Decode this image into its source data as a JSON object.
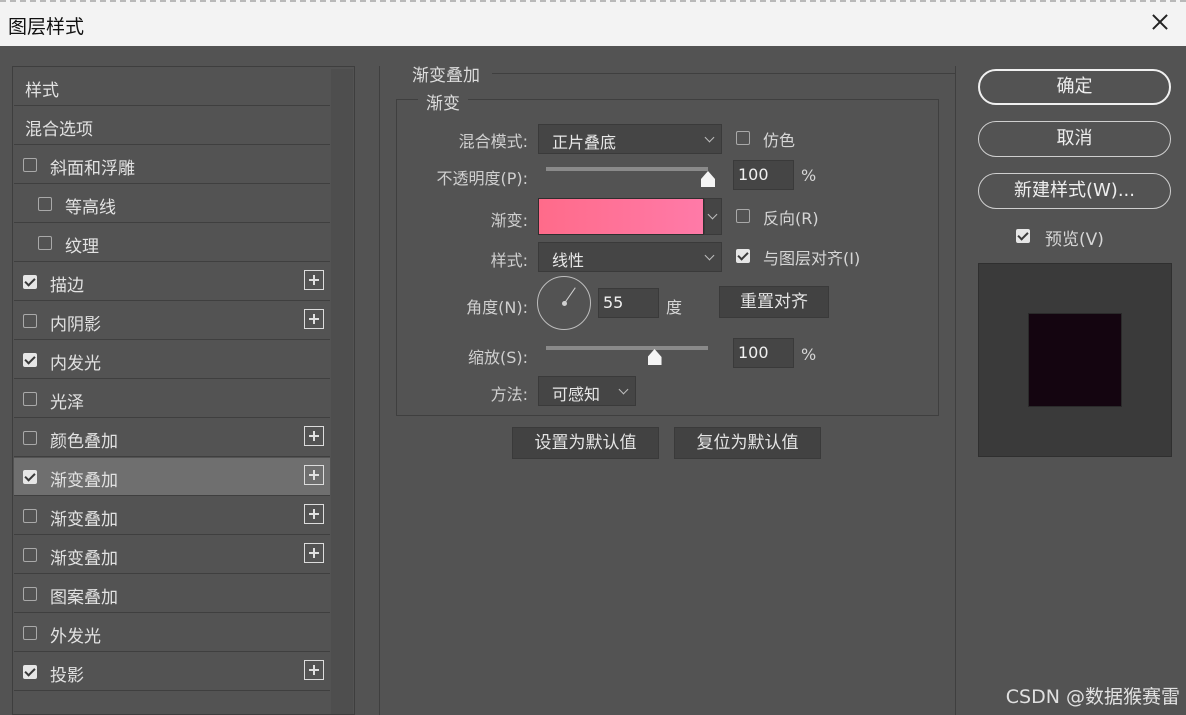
{
  "window": {
    "title": "图层样式"
  },
  "left_panel": {
    "items": [
      {
        "label": "样式",
        "type": "header",
        "checked": null,
        "plus": false
      },
      {
        "label": "混合选项",
        "type": "header",
        "checked": null,
        "plus": false
      },
      {
        "label": "斜面和浮雕",
        "type": "item",
        "checked": false,
        "plus": false
      },
      {
        "label": "等高线",
        "type": "sub",
        "checked": false,
        "plus": false
      },
      {
        "label": "纹理",
        "type": "sub",
        "checked": false,
        "plus": false
      },
      {
        "label": "描边",
        "type": "item",
        "checked": true,
        "plus": true
      },
      {
        "label": "内阴影",
        "type": "item",
        "checked": false,
        "plus": true
      },
      {
        "label": "内发光",
        "type": "item",
        "checked": true,
        "plus": false
      },
      {
        "label": "光泽",
        "type": "item",
        "checked": false,
        "plus": false
      },
      {
        "label": "颜色叠加",
        "type": "item",
        "checked": false,
        "plus": true
      },
      {
        "label": "渐变叠加",
        "type": "item",
        "checked": true,
        "plus": true,
        "active": true
      },
      {
        "label": "渐变叠加",
        "type": "item",
        "checked": false,
        "plus": true
      },
      {
        "label": "渐变叠加",
        "type": "item",
        "checked": false,
        "plus": true
      },
      {
        "label": "图案叠加",
        "type": "item",
        "checked": false,
        "plus": false
      },
      {
        "label": "外发光",
        "type": "item",
        "checked": false,
        "plus": false
      },
      {
        "label": "投影",
        "type": "item",
        "checked": true,
        "plus": true
      }
    ]
  },
  "gradient_overlay": {
    "group_title": "渐变叠加",
    "section_title": "渐变",
    "blend_mode": {
      "label": "混合模式:",
      "value": "正片叠底"
    },
    "dither": {
      "label": "仿色",
      "checked": false
    },
    "opacity": {
      "label": "不透明度(P):",
      "value": "100",
      "unit": "%",
      "level": 1.0
    },
    "gradient": {
      "label": "渐变:",
      "color_start": "#ff6b8a",
      "color_end": "#ff7aa8"
    },
    "reverse": {
      "label": "反向(R)",
      "checked": false
    },
    "style": {
      "label": "样式:",
      "value": "线性"
    },
    "align_with_layer": {
      "label": "与图层对齐(I)",
      "checked": true
    },
    "angle": {
      "label": "角度(N):",
      "value": "55",
      "unit": "度"
    },
    "reset_alignment_button": "重置对齐",
    "scale": {
      "label": "缩放(S):",
      "value": "100",
      "unit": "%",
      "level": 0.67
    },
    "method": {
      "label": "方法:",
      "value": "可感知"
    },
    "set_default_button": "设置为默认值",
    "reset_default_button": "复位为默认值"
  },
  "right_panel": {
    "ok_button": "确定",
    "cancel_button": "取消",
    "new_style_button": "新建样式(W)...",
    "preview": {
      "label": "预览(V)",
      "checked": true,
      "swatch_color": "#140510"
    }
  },
  "watermark": "CSDN @数据猴赛雷"
}
